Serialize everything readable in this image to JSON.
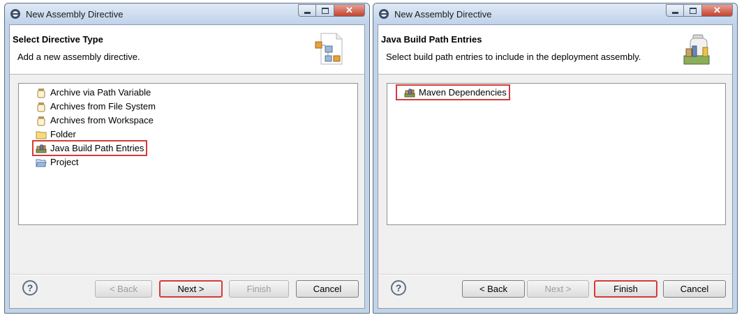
{
  "left": {
    "title": "New Assembly Directive",
    "header": {
      "title": "Select Directive Type",
      "description": "Add a new assembly directive."
    },
    "items": [
      {
        "label": "Archive via Path Variable"
      },
      {
        "label": "Archives from File System"
      },
      {
        "label": "Archives from Workspace"
      },
      {
        "label": "Folder"
      },
      {
        "label": "Java Build Path Entries"
      },
      {
        "label": "Project"
      }
    ],
    "buttons": {
      "back": "< Back",
      "next": "Next >",
      "finish": "Finish",
      "cancel": "Cancel"
    }
  },
  "right": {
    "title": "New Assembly Directive",
    "header": {
      "title": "Java Build Path Entries",
      "description": "Select build path entries to include in the deployment assembly."
    },
    "items": [
      {
        "label": "Maven Dependencies"
      }
    ],
    "buttons": {
      "back": "< Back",
      "next": "Next >",
      "finish": "Finish",
      "cancel": "Cancel"
    }
  },
  "help_symbol": "?",
  "highlight_color": "#d63a3a"
}
